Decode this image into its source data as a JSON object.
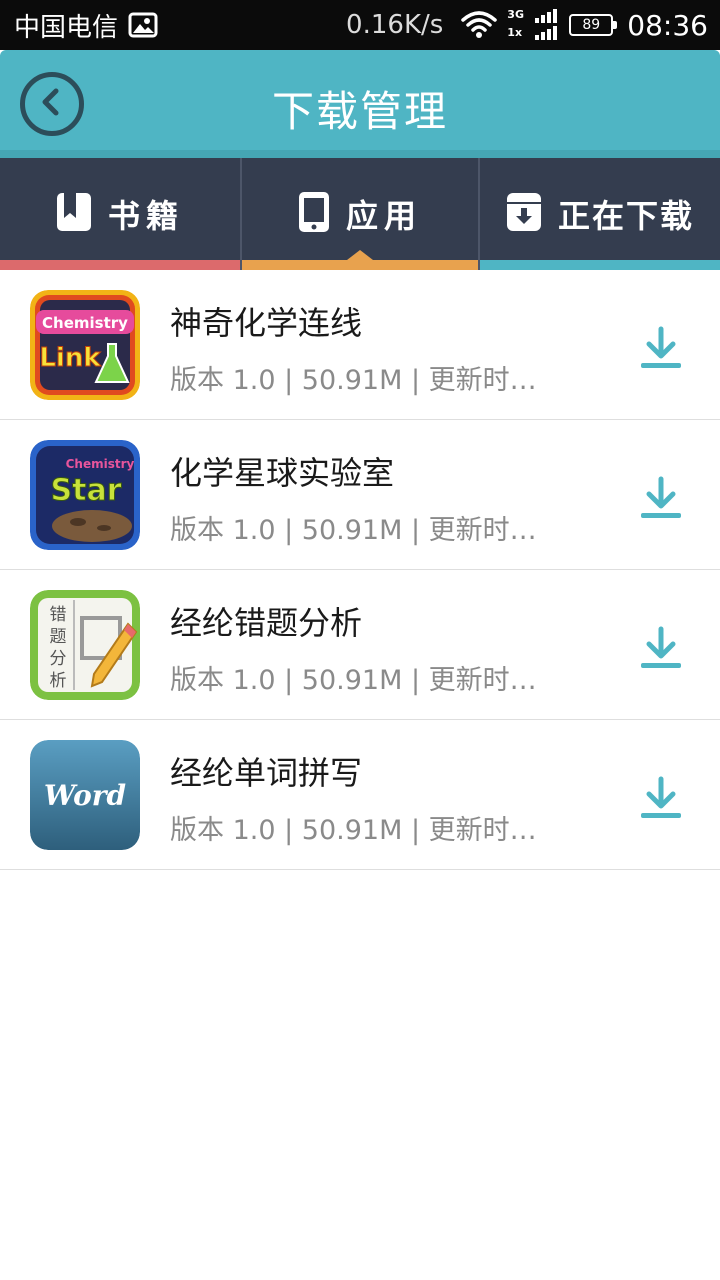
{
  "status_bar": {
    "carrier": "中国电信",
    "net_speed": "0.16K/s",
    "signal_label_top": "3G",
    "signal_label_bottom": "1x",
    "battery": "89",
    "time": "08:36"
  },
  "header": {
    "title": "下载管理"
  },
  "tabs": [
    {
      "label": "书籍",
      "icon": "book-icon"
    },
    {
      "label": "应用",
      "icon": "phone-icon",
      "active": true
    },
    {
      "label": "正在下载",
      "icon": "download-box-icon"
    }
  ],
  "colors": {
    "header": "#4fb5c4",
    "tab_bg": "#343d4f",
    "tab_books": "#dc6a6c",
    "tab_apps": "#e8a24e",
    "tab_downloading": "#4fb5c4",
    "download_icon": "#4fb5c4"
  },
  "apps": [
    {
      "name": "神奇化学连线",
      "meta": "版本 1.0 | 50.91M | 更新时…",
      "icon": "chemistry-link-icon",
      "icon_top": "Chemistry",
      "icon_main": "Link"
    },
    {
      "name": "化学星球实验室",
      "meta": "版本 1.0 | 50.91M | 更新时…",
      "icon": "chemistry-star-icon",
      "icon_top": "Chemistry",
      "icon_main": "Star"
    },
    {
      "name": "经纶错题分析",
      "meta": "版本 1.0 | 50.91M | 更新时…",
      "icon": "error-analysis-icon",
      "icon_chars": [
        "错",
        "题",
        "分",
        "析"
      ]
    },
    {
      "name": "经纶单词拼写",
      "meta": "版本 1.0 | 50.91M | 更新时…",
      "icon": "word-spelling-icon",
      "icon_main": "Word"
    }
  ]
}
